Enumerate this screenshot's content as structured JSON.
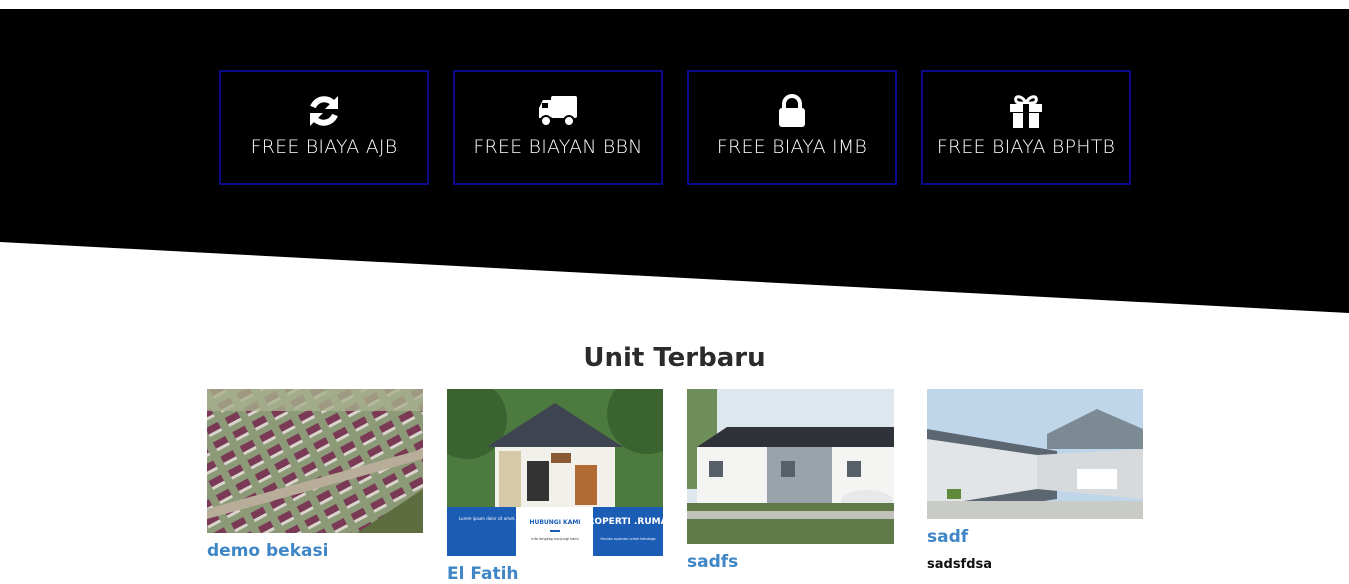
{
  "features": [
    {
      "label": "FREE BIAYA AJB",
      "icon": "refresh-icon"
    },
    {
      "label": "FREE BIAYAN BBN",
      "icon": "truck-icon"
    },
    {
      "label": "FREE BIAYA IMB",
      "icon": "lock-icon"
    },
    {
      "label": "FREE BIAYA BPHTB",
      "icon": "gift-icon"
    }
  ],
  "colors": {
    "hero_bg": "#000000",
    "feature_border": "#0a0a8a",
    "link": "#3f86c6",
    "heading": "#2b2b2b"
  },
  "section": {
    "title": "Unit Terbaru"
  },
  "units": [
    {
      "title": "demo bekasi",
      "desc": ""
    },
    {
      "title": "El Fatih",
      "desc": ""
    },
    {
      "title": "sadfs",
      "desc": ""
    },
    {
      "title": "sadf",
      "desc": "sadsfdsa"
    }
  ],
  "banner": {
    "left_text": "Lorem ipsum dolor sit amet, consectetur",
    "center_title": "HUBUNGI KAMI",
    "center_text": "Info lengkap kunjungi kami",
    "right_title": "PROPERTI .RUMAH",
    "right_text": "Hunian nyaman untuk keluarga"
  }
}
